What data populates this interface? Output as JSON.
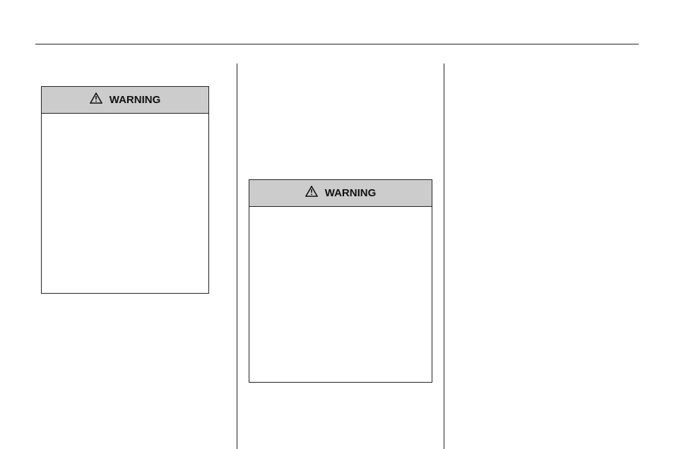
{
  "warning_box_a": {
    "label": "WARNING",
    "body": ""
  },
  "warning_box_b": {
    "label": "WARNING",
    "body": ""
  }
}
